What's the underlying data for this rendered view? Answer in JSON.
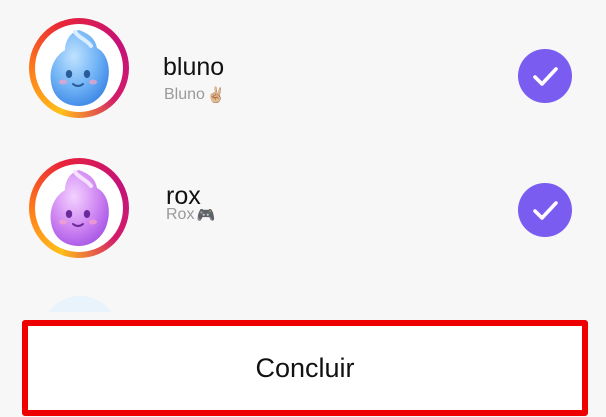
{
  "contacts": [
    {
      "name": "bluno",
      "display_name": "Bluno",
      "emoji": "✌🏼",
      "avatar_color": "#5aa6f2",
      "selected": true
    },
    {
      "name": "rox",
      "display_name": "Rox",
      "emoji": "🎮",
      "avatar_color": "#c77af0",
      "selected": true
    }
  ],
  "footer": {
    "done_label": "Concluir"
  },
  "colors": {
    "check_fill": "#7b5cf0",
    "highlight_border": "#ee0000",
    "ring_gradient": [
      "#ffc21a",
      "#ff7a1a",
      "#e8233a",
      "#c4127a"
    ]
  }
}
